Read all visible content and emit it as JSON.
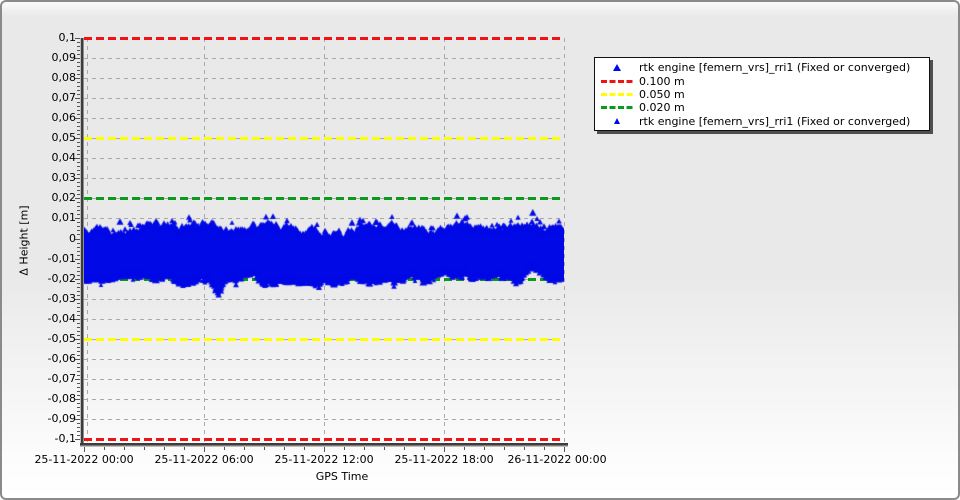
{
  "window": {
    "background_top": "#e9e9e9",
    "background_bottom": "#ffffff",
    "border_color": "#8a8a8a"
  },
  "chart_data": {
    "type": "scatter",
    "title": "",
    "xlabel": "GPS Time",
    "ylabel": "Δ Height [m]",
    "ylim": [
      -0.1,
      0.1
    ],
    "y_step": 0.01,
    "grid": true,
    "y_ticks": [
      "0,1",
      "0,09",
      "0,08",
      "0,07",
      "0,06",
      "0,05",
      "0,04",
      "0,03",
      "0,02",
      "0,01",
      "0",
      "-0,01",
      "-0,02",
      "-0,03",
      "-0,04",
      "-0,05",
      "-0,06",
      "-0,07",
      "-0,08",
      "-0,09",
      "-0,1"
    ],
    "x_ticks": [
      "25-11-2022 00:00",
      "25-11-2022 06:00",
      "25-11-2022 12:00",
      "25-11-2022 18:00",
      "26-11-2022 00:00"
    ],
    "reference_lines": [
      {
        "label": "0.100 m",
        "value": 0.1,
        "mirrored": true,
        "color": "#ee1414"
      },
      {
        "label": "0.050 m",
        "value": 0.05,
        "mirrored": true,
        "color": "#ffff00"
      },
      {
        "label": "0.020 m",
        "value": 0.02,
        "mirrored": true,
        "color": "#0c9a1d"
      }
    ],
    "series": [
      {
        "name": "rtk engine [femern_vrs]_rri1 (Fixed or converged)",
        "marker": "triangle-icon",
        "color": "#0009e6",
        "band": {
          "top_typical": 0.0045,
          "top_max": 0.0095,
          "bottom_typical": -0.02,
          "bottom_min": -0.0233,
          "description": "dense noisy band of fixed RTK height residuals between about +0.008 m and -0.021 m for the full day"
        },
        "features": {
          "dip": {
            "time": "25-11-2022 06:45",
            "x_frac": 0.279,
            "min_value": -0.029
          },
          "outlier": {
            "time": "25-11-2022 22:25",
            "x_frac": 0.935,
            "value": 0.0125
          }
        },
        "render_seed": 1337
      }
    ],
    "legend": {
      "position": "top-right",
      "entries": [
        {
          "marker": "triangle",
          "color": "#0009e6",
          "label": "rtk engine [femern_vrs]_rri1 (Fixed or converged)"
        },
        {
          "marker": "dashes",
          "color": "#ee1414",
          "label": "0.100 m"
        },
        {
          "marker": "dashes",
          "color": "#ffff00",
          "label": "0.050 m"
        },
        {
          "marker": "dashes",
          "color": "#0c9a1d",
          "label": "0.020 m"
        },
        {
          "marker": "triangle-small",
          "color": "#0009e6",
          "label": "rtk engine [femern_vrs]_rri1 (Fixed or converged)"
        }
      ]
    }
  }
}
